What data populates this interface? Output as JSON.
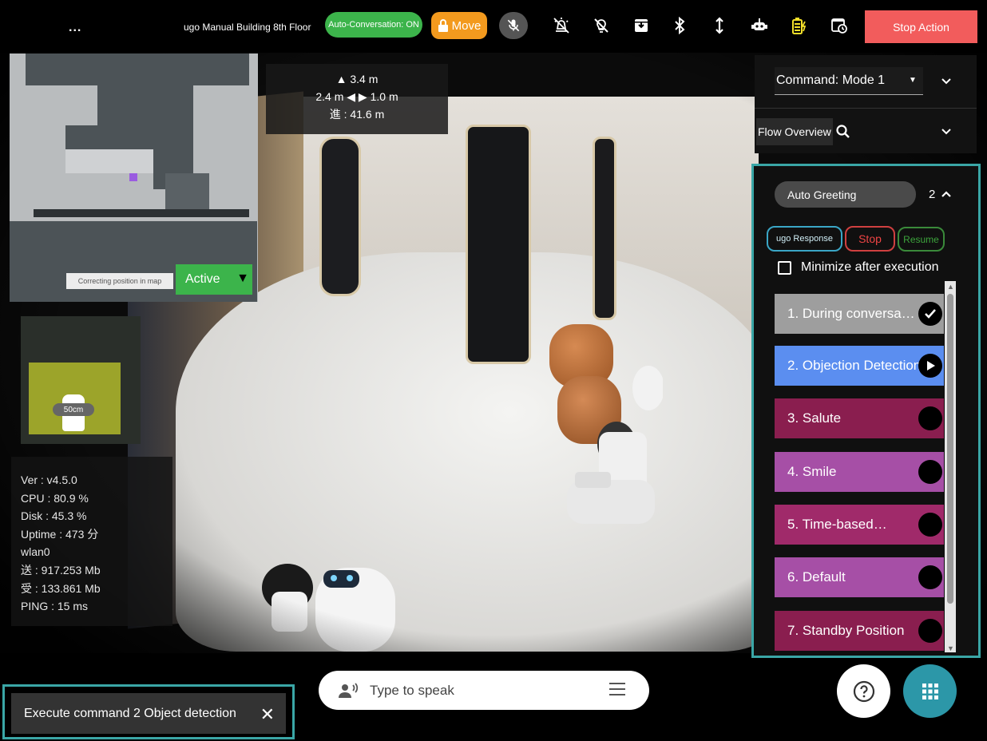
{
  "topbar": {
    "menu_label": "...",
    "location": "ugo Manual Building 8th Floor",
    "auto_conversation": "Auto-Conversation: ON",
    "move_label": "Move",
    "stop_action": "Stop Action",
    "colors": {
      "auto_conversation": "#3cb44b",
      "move": "#f39a1e",
      "stop_action": "#f25c5c"
    }
  },
  "distance": {
    "forward": "3.4 m",
    "left": "2.4 m",
    "right": "1.0 m",
    "traveled": "進 : 41.6 m"
  },
  "map": {
    "correcting_label": "Correcting position in map",
    "status": "Active"
  },
  "lidar": {
    "scale": "50cm"
  },
  "stats": [
    "Ver : v4.5.0",
    "CPU : 80.9 %",
    "Disk : 45.3 %",
    "Uptime : 473 分",
    "wlan0",
    "送 : 917.253 Mb",
    "受 : 133.861 Mb",
    "PING : 15 ms"
  ],
  "command": {
    "selected": "Command: Mode 1",
    "flow_overview": "Flow Overview"
  },
  "flow": {
    "name": "Auto Greeting",
    "count": "2",
    "response_label": "ugo Response",
    "stop_label": "Stop",
    "resume_label": "Resume",
    "minimize_label": "Minimize after execution",
    "steps": [
      {
        "label": "1. During conversa…",
        "state": "done",
        "color": "#9e9e9e"
      },
      {
        "label": "2. Objection Detection",
        "state": "running",
        "color": "#5b8ef0"
      },
      {
        "label": "3. Salute",
        "state": "pending",
        "color": "#8a1e4f"
      },
      {
        "label": "4. Smile",
        "state": "pending",
        "color": "#a64fa6"
      },
      {
        "label": "5. Time-based…",
        "state": "pending",
        "color": "#a02a6a"
      },
      {
        "label": "6. Default",
        "state": "pending",
        "color": "#a64fa6"
      },
      {
        "label": "7. Standby Position",
        "state": "pending",
        "color": "#8a1e4f"
      }
    ]
  },
  "toast": {
    "message": "Execute command 2 Object detection"
  },
  "speak": {
    "placeholder": "Type to speak"
  }
}
